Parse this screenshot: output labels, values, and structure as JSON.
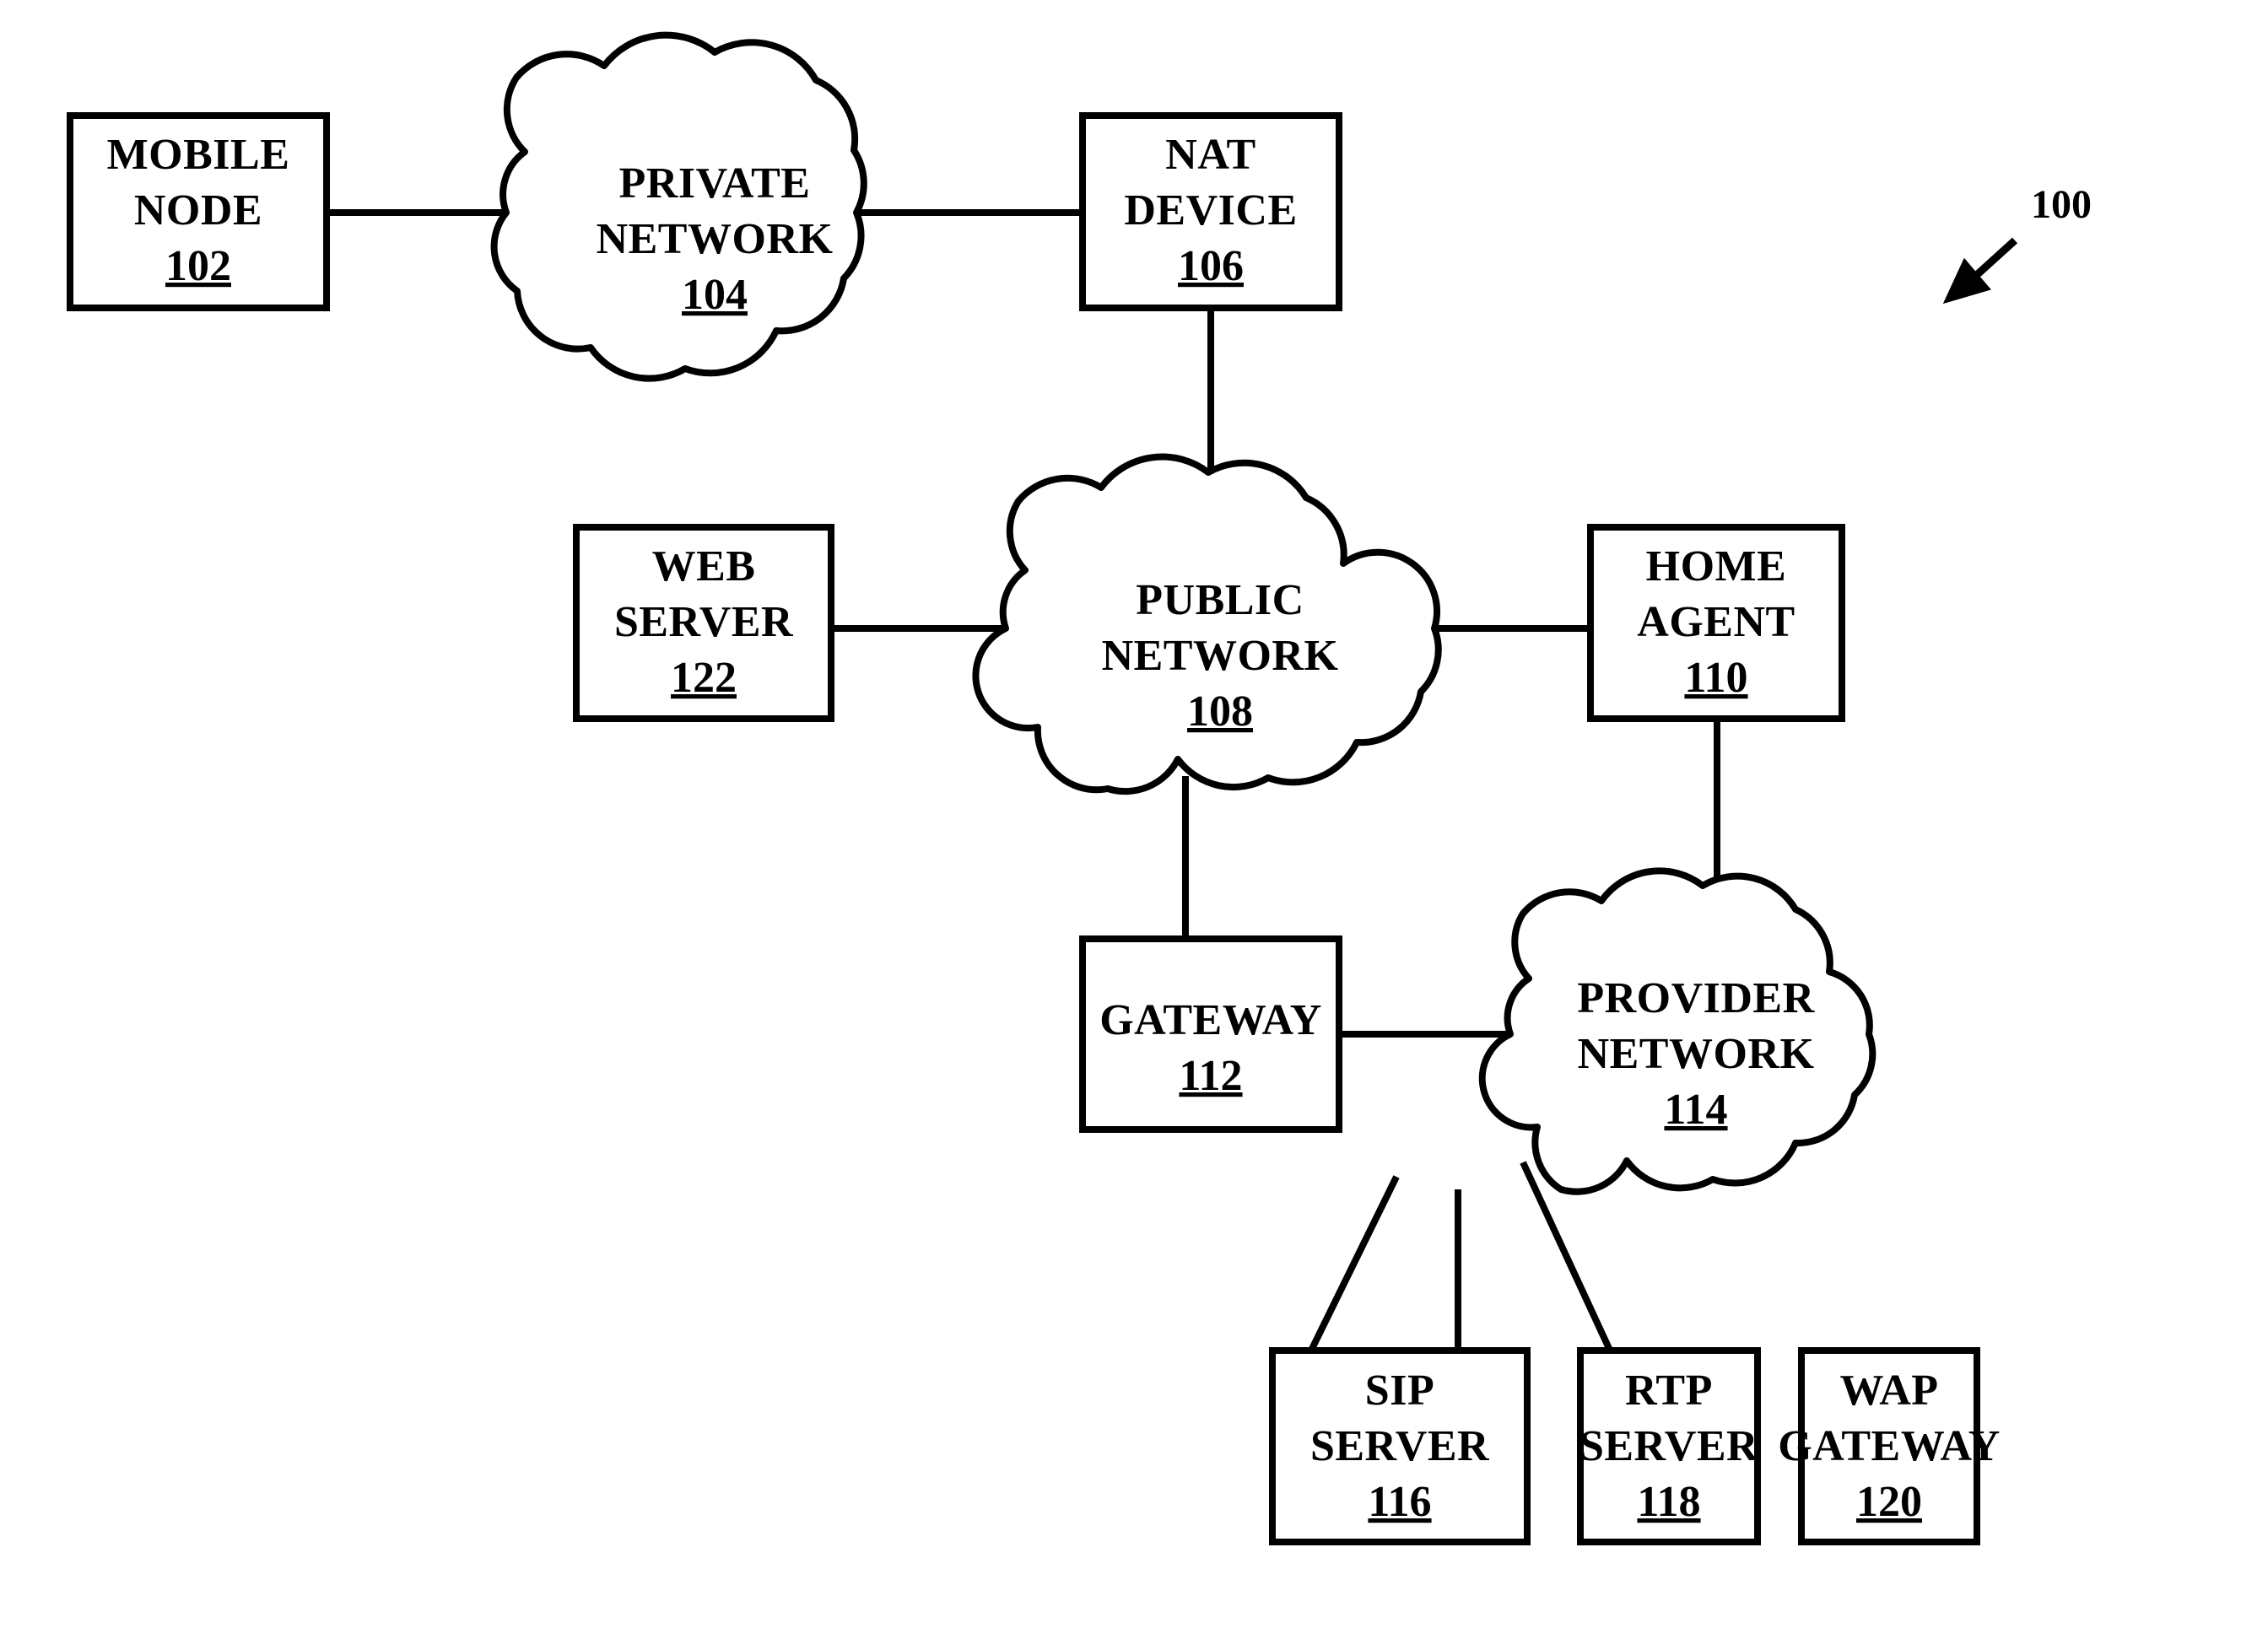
{
  "figure": {
    "reference_numeral": "100",
    "background_color": "#ffffff",
    "line_color": "#000000",
    "pointer_arrow": "diagonal-arrow-down-left"
  },
  "nodes": [
    {
      "id": "mobile-node",
      "shape": "box",
      "lines": [
        "MOBILE",
        "NODE"
      ],
      "line1": "MOBILE",
      "line2": "NODE",
      "ref": "102"
    },
    {
      "id": "private-network",
      "shape": "cloud",
      "lines": [
        "PRIVATE",
        "NETWORK"
      ],
      "line1": "PRIVATE",
      "line2": "NETWORK",
      "ref": "104"
    },
    {
      "id": "nat-device",
      "shape": "box",
      "lines": [
        "NAT",
        "DEVICE"
      ],
      "line1": "NAT",
      "line2": "DEVICE",
      "ref": "106"
    },
    {
      "id": "public-network",
      "shape": "cloud",
      "lines": [
        "PUBLIC",
        "NETWORK"
      ],
      "line1": "PUBLIC",
      "line2": "NETWORK",
      "ref": "108"
    },
    {
      "id": "home-agent",
      "shape": "box",
      "lines": [
        "HOME",
        "AGENT"
      ],
      "line1": "HOME",
      "line2": "AGENT",
      "ref": "110"
    },
    {
      "id": "gateway",
      "shape": "box",
      "lines": [
        "GATEWAY"
      ],
      "line1": "GATEWAY",
      "line2": "",
      "ref": "112"
    },
    {
      "id": "provider-network",
      "shape": "cloud",
      "lines": [
        "PROVIDER",
        "NETWORK"
      ],
      "line1": "PROVIDER",
      "line2": "NETWORK",
      "ref": "114"
    },
    {
      "id": "sip-server",
      "shape": "box",
      "lines": [
        "SIP",
        "SERVER"
      ],
      "line1": "SIP",
      "line2": "SERVER",
      "ref": "116"
    },
    {
      "id": "rtp-server",
      "shape": "box",
      "lines": [
        "RTP",
        "SERVER"
      ],
      "line1": "RTP",
      "line2": "SERVER",
      "ref": "118"
    },
    {
      "id": "wap-gateway",
      "shape": "box",
      "lines": [
        "WAP",
        "GATEWAY"
      ],
      "line1": "WAP",
      "line2": "GATEWAY",
      "ref": "120"
    },
    {
      "id": "web-server",
      "shape": "box",
      "lines": [
        "WEB",
        "SERVER"
      ],
      "line1": "WEB",
      "line2": "SERVER",
      "ref": "122"
    }
  ],
  "connections": [
    {
      "from": "mobile-node",
      "to": "private-network",
      "style": "straight-horizontal"
    },
    {
      "from": "private-network",
      "to": "nat-device",
      "style": "straight-horizontal"
    },
    {
      "from": "nat-device",
      "to": "public-network",
      "style": "straight-vertical"
    },
    {
      "from": "web-server",
      "to": "public-network",
      "style": "straight-horizontal"
    },
    {
      "from": "public-network",
      "to": "home-agent",
      "style": "straight-horizontal"
    },
    {
      "from": "public-network",
      "to": "gateway",
      "style": "straight-vertical"
    },
    {
      "from": "gateway",
      "to": "provider-network",
      "style": "straight-horizontal"
    },
    {
      "from": "home-agent",
      "to": "provider-network",
      "style": "straight-vertical"
    },
    {
      "from": "provider-network",
      "to": "sip-server",
      "style": "diagonal"
    },
    {
      "from": "provider-network",
      "to": "rtp-server",
      "style": "straight-vertical"
    },
    {
      "from": "provider-network",
      "to": "wap-gateway",
      "style": "diagonal"
    }
  ]
}
